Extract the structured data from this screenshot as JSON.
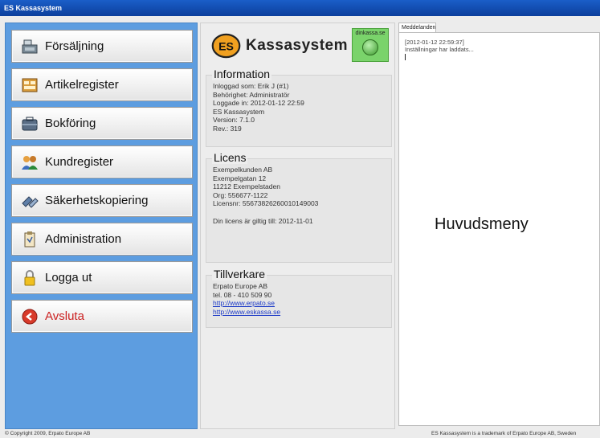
{
  "window": {
    "title": "ES Kassasystem"
  },
  "menu": [
    {
      "label": "Försäljning",
      "icon": "cash-register-icon"
    },
    {
      "label": "Artikelregister",
      "icon": "article-register-icon"
    },
    {
      "label": "Bokföring",
      "icon": "accounting-case-icon"
    },
    {
      "label": "Kundregister",
      "icon": "customers-icon"
    },
    {
      "label": "Säkerhetskopiering",
      "icon": "backup-icon"
    },
    {
      "label": "Administration",
      "icon": "clipboard-icon"
    },
    {
      "label": "Logga ut",
      "icon": "lock-icon"
    },
    {
      "label": "Avsluta",
      "icon": "exit-icon",
      "color": "#cc2222"
    }
  ],
  "logo": {
    "name": "Kassasystem",
    "mark": "ES"
  },
  "dinkassa": {
    "label": "dinkassa.se",
    "status_color": "#4aa23a"
  },
  "information": {
    "heading": "Information",
    "lines": [
      "Inloggad som: Erik J (#1)",
      "Behörighet: Administratör",
      "Loggade in: 2012-01-12 22:59",
      "ES Kassasystem",
      "Version: 7.1.0",
      "Rev.: 319"
    ]
  },
  "licens": {
    "heading": "Licens",
    "lines": [
      "Exempelkunden AB",
      "Exempelgatan 12",
      "11212    Exempelstaden",
      "Org: 556677-1122",
      "Licensnr: 55673826260010149003"
    ],
    "validity": "Din licens är giltig till: 2012-11-01"
  },
  "tillverkare": {
    "heading": "Tillverkare",
    "lines": [
      "Erpato Europe AB",
      "tel. 08 - 410 509 90"
    ],
    "links": [
      "http://www.erpato.se",
      "http://www.eskassa.se"
    ]
  },
  "messages": {
    "tab": "Meddelanden",
    "lines": [
      "[2012-01-12 22:59:37]",
      "Inställningar har laddats..."
    ],
    "main_label": "Huvudsmeny"
  },
  "footer": {
    "left": "© Copyright 2009, Erpato Europe AB",
    "right": "ES Kassasystem is a trademark of Erpato Europe AB, Sweden"
  }
}
